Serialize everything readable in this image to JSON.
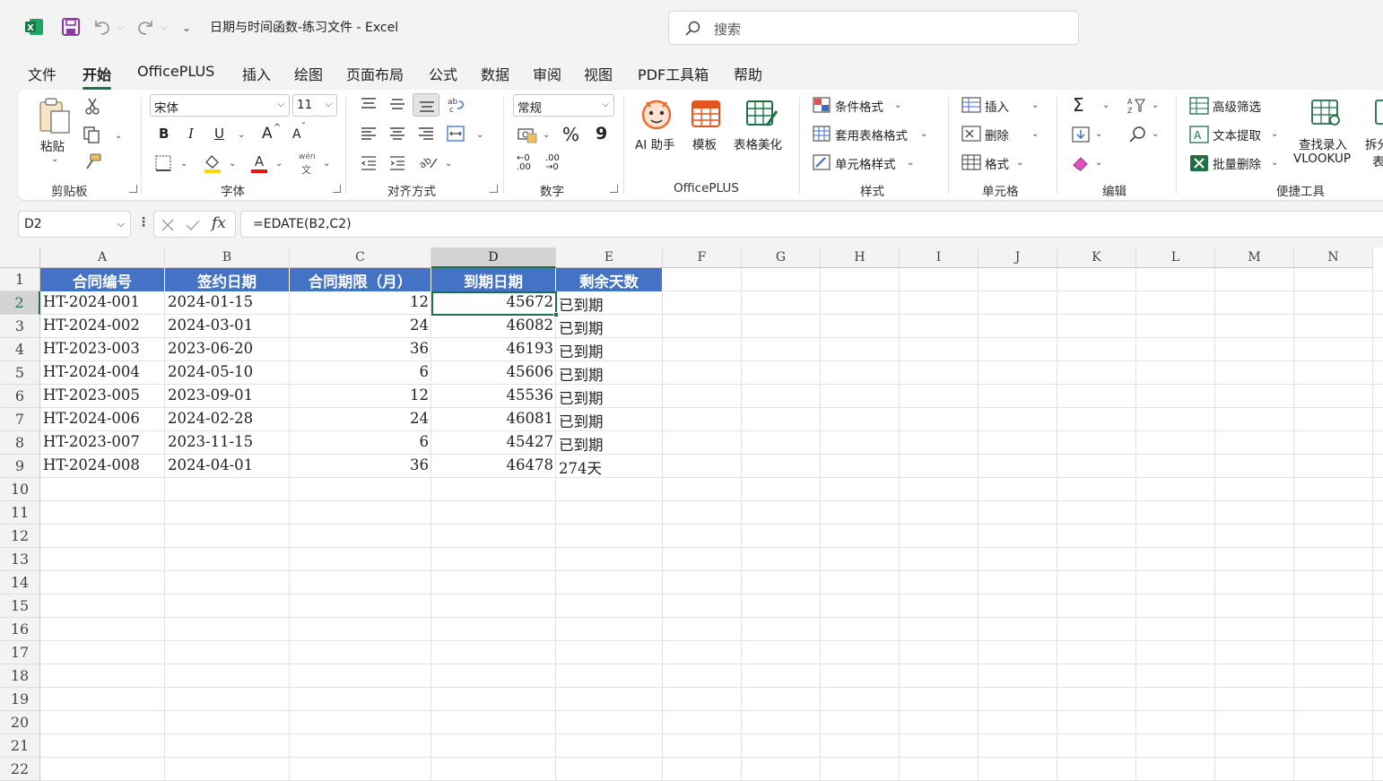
{
  "app": {
    "title": "日期与时间函数-练习文件  -  Excel",
    "search_placeholder": "搜索"
  },
  "menu_tabs": [
    "文件",
    "开始",
    "OfficePLUS",
    "插入",
    "绘图",
    "页面布局",
    "公式",
    "数据",
    "审阅",
    "视图",
    "PDF工具箱",
    "帮助"
  ],
  "active_tab": "开始",
  "ribbon": {
    "clipboard": {
      "label": "剪贴板",
      "paste": "粘贴"
    },
    "font": {
      "label": "字体",
      "font_name": "宋体",
      "font_size": "11",
      "bold": "B",
      "italic": "I",
      "underline": "U",
      "grow": "A",
      "shrink": "A",
      "phonetic_top": "wén",
      "phonetic_bottom": "文"
    },
    "alignment": {
      "label": "对齐方式"
    },
    "number": {
      "label": "数字",
      "format": "常规",
      "percent": "%",
      "comma": "9",
      "inc_decimal": "←0 .00",
      "dec_decimal": ".00 →0"
    },
    "officeplus": {
      "label": "OfficePLUS",
      "ai": "AI 助手",
      "template": "模板",
      "beautify": "表格美化"
    },
    "styles": {
      "label": "样式",
      "conditional": "条件格式",
      "table_format": "套用表格格式",
      "cell_style": "单元格样式"
    },
    "cells": {
      "label": "单元格",
      "insert": "插入",
      "delete": "删除",
      "format": "格式"
    },
    "editing": {
      "label": "编辑"
    },
    "quick_tools": {
      "label": "便捷工具",
      "advanced_filter": "高级筛选",
      "text_extract": "文本提取",
      "batch_delete": "批量删除",
      "lookup_line1": "查找录入",
      "lookup_line2": "VLOOKUP",
      "split_line1": "拆分",
      "split_line2": "表"
    }
  },
  "formula_bar": {
    "name_box": "D2",
    "fx": "fx",
    "formula": "=EDATE(B2,C2)"
  },
  "columns": [
    "A",
    "B",
    "C",
    "D",
    "E",
    "F",
    "G",
    "H",
    "I",
    "J",
    "K",
    "L",
    "M",
    "N"
  ],
  "selected_column": "D",
  "selected_row": 2,
  "row_numbers": [
    "1",
    "2",
    "3",
    "4",
    "5",
    "6",
    "7",
    "8",
    "9",
    "10",
    "11",
    "12",
    "13",
    "14",
    "15",
    "16",
    "17",
    "18",
    "19",
    "20",
    "21",
    "22"
  ],
  "table": {
    "headers": [
      "合同编号",
      "签约日期",
      "合同期限（月）",
      "到期日期",
      "剩余天数"
    ],
    "rows": [
      [
        "HT-2024-001",
        "2024-01-15",
        "12",
        "45672",
        "已到期"
      ],
      [
        "HT-2024-002",
        "2024-03-01",
        "24",
        "46082",
        "已到期"
      ],
      [
        "HT-2023-003",
        "2023-06-20",
        "36",
        "46193",
        "已到期"
      ],
      [
        "HT-2024-004",
        "2024-05-10",
        "6",
        "45606",
        "已到期"
      ],
      [
        "HT-2023-005",
        "2023-09-01",
        "12",
        "45536",
        "已到期"
      ],
      [
        "HT-2024-006",
        "2024-02-28",
        "24",
        "46081",
        "已到期"
      ],
      [
        "HT-2023-007",
        "2023-11-15",
        "6",
        "45427",
        "已到期"
      ],
      [
        "HT-2024-008",
        "2024-04-01",
        "36",
        "46478",
        "274天"
      ]
    ]
  },
  "colors": {
    "accent": "#1e7145",
    "header_fill": "#4472c4",
    "header_text": "#ffffff"
  }
}
